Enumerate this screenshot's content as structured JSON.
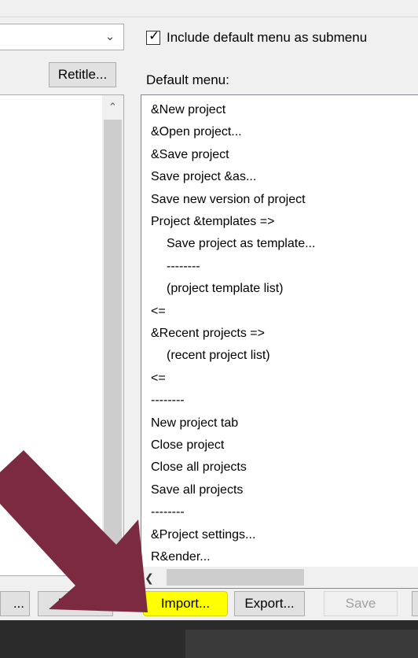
{
  "top": {
    "dropdown_chevron": "chevron-down-icon",
    "retitle_label": "Retitle...",
    "include_checkbox": {
      "checked": true,
      "label": "Include default menu as submenu"
    },
    "default_menu_label": "Default menu:"
  },
  "default_menu_items": [
    {
      "text": "&New project",
      "indent": false
    },
    {
      "text": "&Open project...",
      "indent": false
    },
    {
      "text": "&Save project",
      "indent": false
    },
    {
      "text": "Save project &as...",
      "indent": false
    },
    {
      "text": "Save new version of project",
      "indent": false
    },
    {
      "text": "Project &templates =>",
      "indent": false
    },
    {
      "text": "Save project as template...",
      "indent": true
    },
    {
      "text": "--------",
      "indent": true
    },
    {
      "text": "(project template list)",
      "indent": true
    },
    {
      "text": "<=",
      "indent": false
    },
    {
      "text": "&Recent projects =>",
      "indent": false
    },
    {
      "text": "(recent project list)",
      "indent": true
    },
    {
      "text": "<=",
      "indent": false
    },
    {
      "text": "--------",
      "indent": false
    },
    {
      "text": "New project tab",
      "indent": false
    },
    {
      "text": "Close project",
      "indent": false
    },
    {
      "text": "Close all projects",
      "indent": false
    },
    {
      "text": "Save all projects",
      "indent": false
    },
    {
      "text": "--------",
      "indent": false
    },
    {
      "text": "&Project settings...",
      "indent": false
    },
    {
      "text": "R&ender...",
      "indent": false
    }
  ],
  "buttons": {
    "ellipsis": "...",
    "reset": "Reset",
    "import": "Import...",
    "export": "Export...",
    "save": "Save"
  },
  "colors": {
    "highlight": "#ffff00",
    "annotation_arrow": "#7b2a3f"
  }
}
